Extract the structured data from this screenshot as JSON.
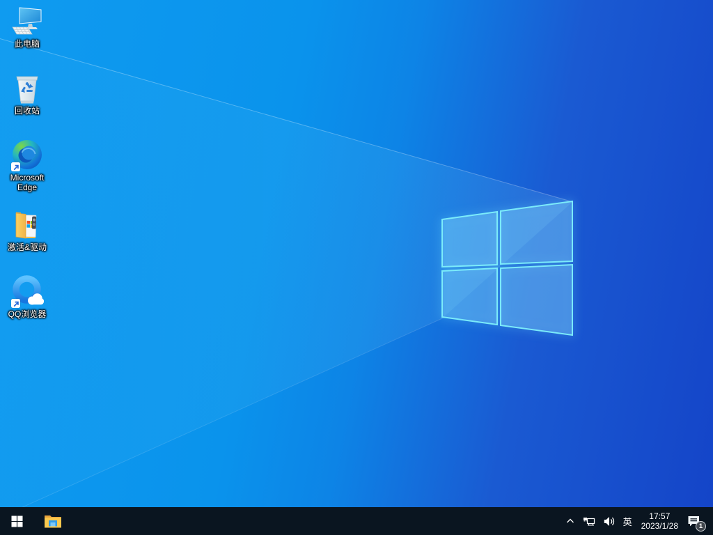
{
  "wallpaper": {
    "base_left_color": "#0f9bf0",
    "base_right_color": "#1444c8",
    "logo_edge_color": "#7ff0fb"
  },
  "desktop": {
    "icons": [
      {
        "label": "此电脑"
      },
      {
        "label": "回收站"
      },
      {
        "label": "Microsoft Edge"
      },
      {
        "label": "激活&驱动"
      },
      {
        "label": "QQ浏览器"
      }
    ]
  },
  "taskbar": {
    "background_color": "#0a1520",
    "tray": {
      "ime": "英",
      "time": "17:57",
      "date": "2023/1/28",
      "notification_badge": "1"
    }
  }
}
